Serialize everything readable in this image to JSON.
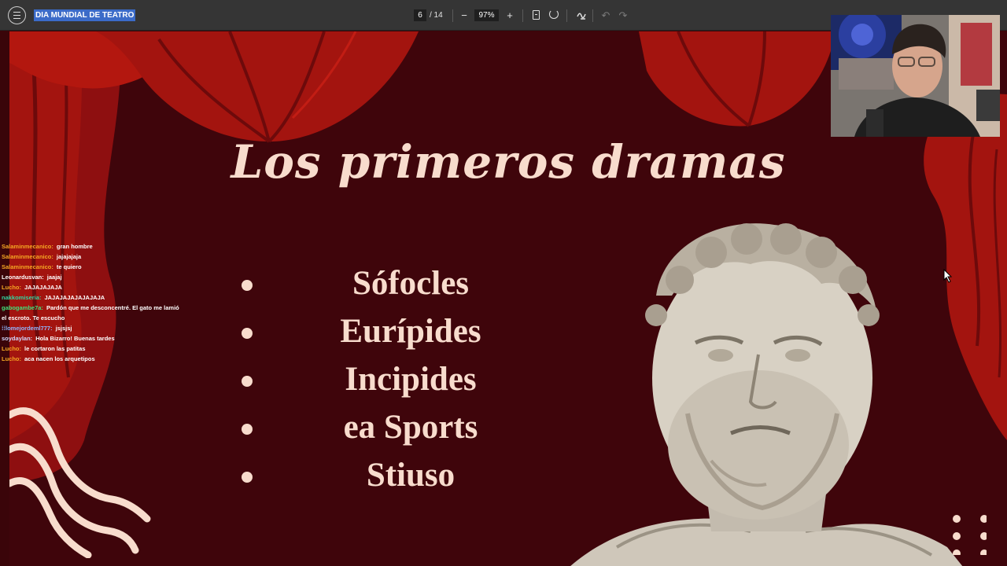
{
  "toolbar": {
    "document_title": "DIA MUNDIAL DE TEATRO",
    "current_page": "6",
    "total_pages": "/ 14",
    "zoom_level": "97%",
    "zoom_out_label": "−",
    "zoom_in_label": "+",
    "undo_label": "↶",
    "redo_label": "↷",
    "icons": [
      "menu-icon",
      "fit-page-icon",
      "rotate-icon",
      "annotate-icon",
      "undo-icon",
      "redo-icon"
    ]
  },
  "slide": {
    "title": "Los primeros dramas",
    "bullets": [
      "Sófocles",
      "Eurípides",
      "Incipides",
      "ea Sports",
      "Stiuso"
    ]
  },
  "chat": {
    "messages": [
      {
        "user": "Salaminmecanico:",
        "text": "gran hombre",
        "color": "#f5a623"
      },
      {
        "user": "Salaminmecanico:",
        "text": "jajajajaja",
        "color": "#f5a623"
      },
      {
        "user": "Salaminmecanico:",
        "text": "te quiero",
        "color": "#f5a623"
      },
      {
        "user": "Leonardusvan:",
        "text": "jaajaj",
        "color": "#ffffff"
      },
      {
        "user": "Lucho:",
        "text": "JAJAJAJAJA",
        "color": "#f5a623"
      },
      {
        "user": "nakkomiseria:",
        "text": "JAJAJAJAJAJAJAJA",
        "color": "#2fd6a0"
      },
      {
        "user": "gabogambe7a:",
        "text": "Pardón que me desconcentré. El gato me lamió el escroto. Te escucho",
        "color": "#3fe07a"
      },
      {
        "user": "lomejordeml777:",
        "text": "jsjsjsj",
        "color": "#8fb6ff",
        "badge": "⁞⁞"
      },
      {
        "user": "soydaylan:",
        "text": "Hola Bizarro! Buenas tardes",
        "color": "#cfd8ff"
      },
      {
        "user": "Lucho:",
        "text": "le cortaron las patitas",
        "color": "#f5a623"
      },
      {
        "user": "Lucho:",
        "text": "aca nacen los arquetipos",
        "color": "#f5a623"
      }
    ]
  },
  "colors": {
    "slide_background": "#3f050b",
    "curtain": "#a3140f",
    "text_cream": "#f8dccd",
    "toolbar": "#353535",
    "title_highlight": "#3b6bc8"
  }
}
